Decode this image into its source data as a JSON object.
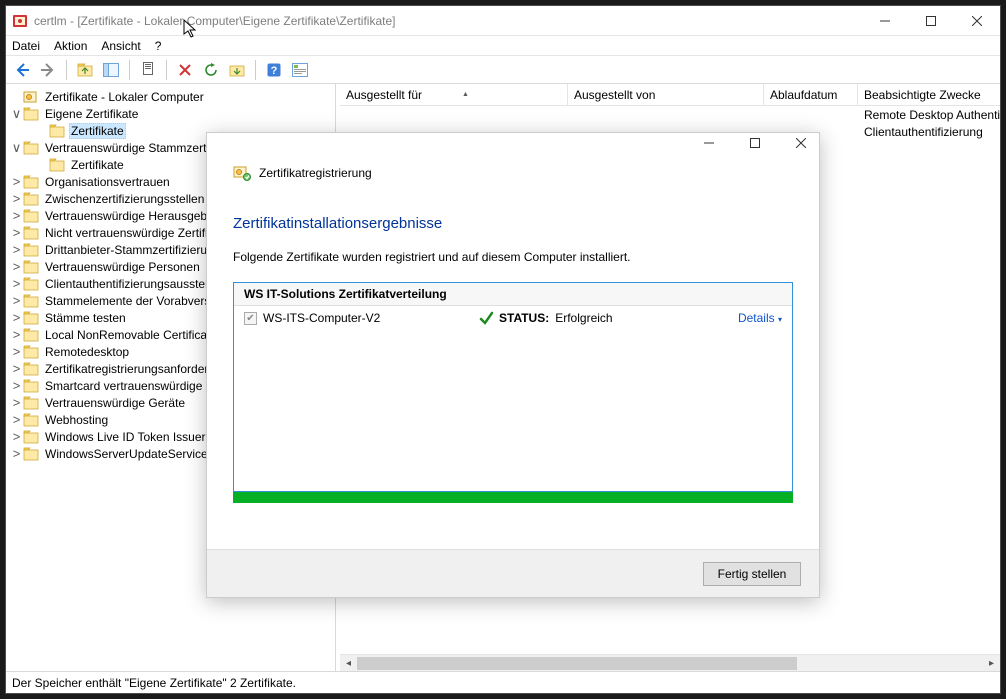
{
  "title": "certlm - [Zertifikate - Lokaler Computer\\Eigene Zertifikate\\Zertifikate]",
  "menu": {
    "file": "Datei",
    "action": "Aktion",
    "view": "Ansicht",
    "help": "?"
  },
  "tree": {
    "root": "Zertifikate - Lokaler Computer",
    "node_own": "Eigene Zertifikate",
    "leaf_own": "Zertifikate",
    "node_trusted": "Vertrauenswürdige Stammzertifizierungsstellen",
    "leaf_trusted": "Zertifikate",
    "others": [
      "Organisationsvertrauen",
      "Zwischenzertifizierungsstellen",
      "Vertrauenswürdige Herausgeber",
      "Nicht vertrauenswürdige Zertifikate",
      "Drittanbieter-Stammzertifizierungsstellen",
      "Vertrauenswürdige Personen",
      "Clientauthentifizierungsaussteller",
      "Stammelemente der Vorabversion",
      "Stämme testen",
      "Local NonRemovable Certificates",
      "Remotedesktop",
      "Zertifikatregistrierungsanforderungen",
      "Smartcard vertrauenswürdige Stämme",
      "Vertrauenswürdige Geräte",
      "Webhosting",
      "Windows Live ID Token Issuer",
      "WindowsServerUpdateServices"
    ]
  },
  "columns": {
    "c1": "Ausgestellt für",
    "c2": "Ausgestellt von",
    "c3": "Ablaufdatum",
    "c4": "Beabsichtigte Zwecke"
  },
  "purposes": {
    "p1": "Remote Desktop Authentication",
    "p2": "Clientauthentifizierung"
  },
  "modal": {
    "wizard": "Zertifikatregistrierung",
    "title": "Zertifikatinstallationsergebnisse",
    "sub": "Folgende Zertifikate wurden registriert und auf diesem Computer installiert.",
    "box_header": "WS IT-Solutions Zertifikatverteilung",
    "item_name": "WS-ITS-Computer-V2",
    "status_label": "STATUS:",
    "status_value": "Erfolgreich",
    "details": "Details",
    "finish": "Fertig stellen"
  },
  "status": "Der Speicher enthält \"Eigene Zertifikate\" 2 Zertifikate."
}
